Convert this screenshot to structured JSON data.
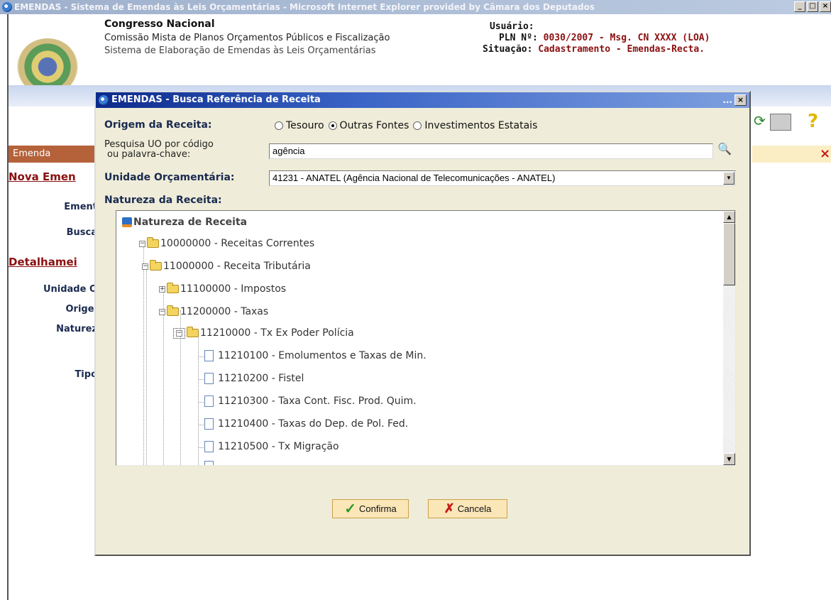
{
  "window": {
    "title": "EMENDAS - Sistema de Emendas às Leis Orçamentárias - Microsoft Internet Explorer provided by Câmara dos Deputados",
    "btn_min": "_",
    "btn_max": "□",
    "btn_close": "×"
  },
  "header": {
    "org": "Congresso Nacional",
    "committee": "Comissão Mista de Planos Orçamentos Públicos e Fiscalização",
    "system": "Sistema de Elaboração de Emendas às Leis Orçamentárias",
    "user_label": "Usuário:",
    "pln_label": "PLN Nº:",
    "pln_value": "0030/2007 - Msg. CN XXXX (LOA)",
    "status_label": "Situação:",
    "status_value": "Cadastramento - Emendas-Recta."
  },
  "background": {
    "emenda_tab": "Emenda",
    "nova_emenda": "Nova Emen",
    "ement": "Ement",
    "buscar": "Busca",
    "detalhamento": "Detalhamei",
    "unidade": "Unidade O",
    "origem": "Origei",
    "natureza": "Naturez",
    "tipo": "Tipo"
  },
  "dialog": {
    "title": "EMENDAS - Busca Referência de Receita",
    "dots": "...",
    "close": "×",
    "origem_label": "Origem da Receita:",
    "radios": [
      {
        "label": "Tesouro",
        "checked": false
      },
      {
        "label": "Outras Fontes",
        "checked": true
      },
      {
        "label": "Investimentos Estatais",
        "checked": false
      }
    ],
    "pesquisa_label_1": "Pesquisa UO por código",
    "pesquisa_label_2": "ou palavra-chave:",
    "pesquisa_value": "agência",
    "unidade_label": "Unidade Orçamentária:",
    "unidade_value": "41231 - ANATEL (Agência Nacional de Telecomunicações - ANATEL)",
    "natureza_label": "Natureza da Receita:",
    "confirm_label": "Confirma",
    "cancel_label": "Cancela"
  },
  "tree": {
    "root": "Natureza de Receita",
    "nodes": [
      "10000000 - Receitas Correntes",
      "11000000 - Receita Tributária",
      "11100000 - Impostos",
      "11200000 - Taxas",
      "11210000 - Tx Ex Poder Polícia",
      "11210100 - Emolumentos e Taxas de Min.",
      "11210200 - Fistel",
      "11210300 - Taxa Cont. Fisc. Prod. Quim.",
      "11210400 - Taxas do Dep. de Pol. Fed.",
      "11210500 - Tx Migração"
    ]
  }
}
